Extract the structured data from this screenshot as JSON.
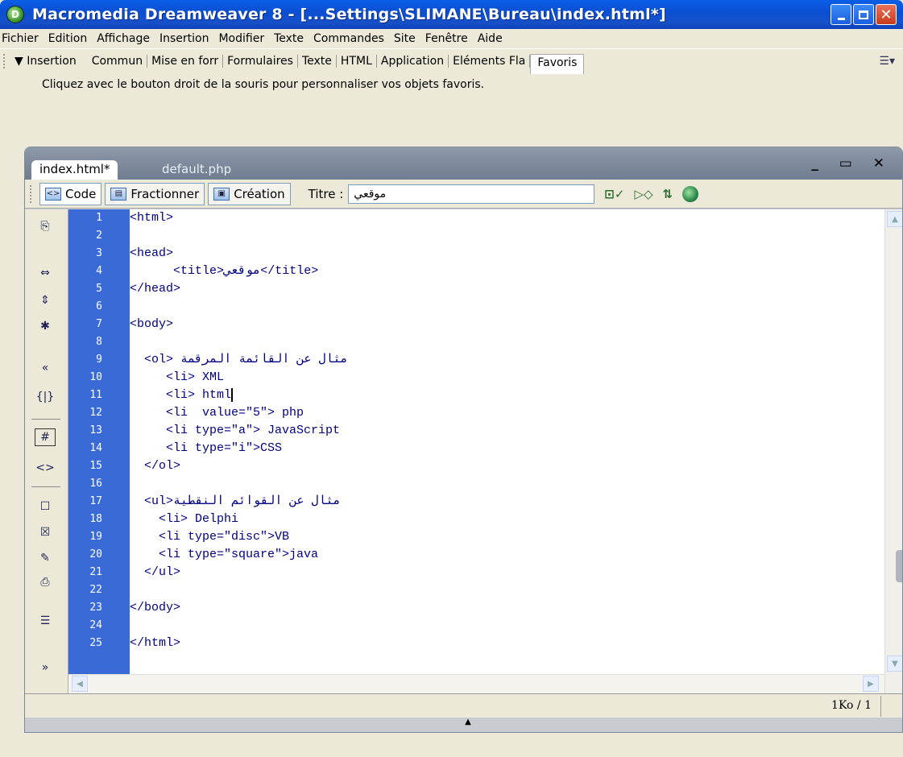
{
  "window": {
    "title": "Macromedia Dreamweaver 8 - [...Settings\\SLIMANE\\Bureau\\index.html*]",
    "app_icon_glyph": "D"
  },
  "menu": [
    "Fichier",
    "Edition",
    "Affichage",
    "Insertion",
    "Modifier",
    "Texte",
    "Commandes",
    "Site",
    "Fenêtre",
    "Aide"
  ],
  "insert_bar": {
    "label": "▼ Insertion",
    "tabs": [
      "Commun",
      "Mise en forr",
      "Formulaires",
      "Texte",
      "HTML",
      "Application",
      "Eléments Fla"
    ],
    "active_tab": "Favoris",
    "hint": "Cliquez avec le bouton droit de la souris pour personnaliser vos objets favoris."
  },
  "document": {
    "tabs": [
      "index.html*",
      "default.php"
    ],
    "window_controls": "_ ▭ ✕",
    "views": {
      "code": "Code",
      "split": "Fractionner",
      "design": "Création"
    },
    "titre_label": "Titre :",
    "titre_value": "موقعي"
  },
  "code_lines": [
    {
      "n": "1",
      "text": "<html>"
    },
    {
      "n": "2",
      "text": ""
    },
    {
      "n": "3",
      "text": "<head>"
    },
    {
      "n": "4",
      "text": "      <title>موقعي</title>"
    },
    {
      "n": "5",
      "text": "</head>"
    },
    {
      "n": "6",
      "text": ""
    },
    {
      "n": "7",
      "text": "<body>"
    },
    {
      "n": "8",
      "text": ""
    },
    {
      "n": "9",
      "text": "  <ol> مثال عن القائمة المرقمة"
    },
    {
      "n": "10",
      "text": "     <li> XML"
    },
    {
      "n": "11",
      "text": "     <li> html"
    },
    {
      "n": "12",
      "text": "     <li  value=\"5\"> php"
    },
    {
      "n": "13",
      "text": "     <li type=\"a\"> JavaScript"
    },
    {
      "n": "14",
      "text": "     <li type=\"i\">CSS"
    },
    {
      "n": "15",
      "text": "  </ol>"
    },
    {
      "n": "16",
      "text": ""
    },
    {
      "n": "17",
      "text": "  <ul>مثال عن القوائم النقطية"
    },
    {
      "n": "18",
      "text": "    <li> Delphi"
    },
    {
      "n": "19",
      "text": "    <li type=\"disc\">VB"
    },
    {
      "n": "20",
      "text": "    <li type=\"square\">java"
    },
    {
      "n": "21",
      "text": "  </ul>"
    },
    {
      "n": "22",
      "text": ""
    },
    {
      "n": "23",
      "text": "</body>"
    },
    {
      "n": "24",
      "text": ""
    },
    {
      "n": "25",
      "text": "</html>"
    }
  ],
  "status": {
    "size": "1Ko / 1"
  }
}
